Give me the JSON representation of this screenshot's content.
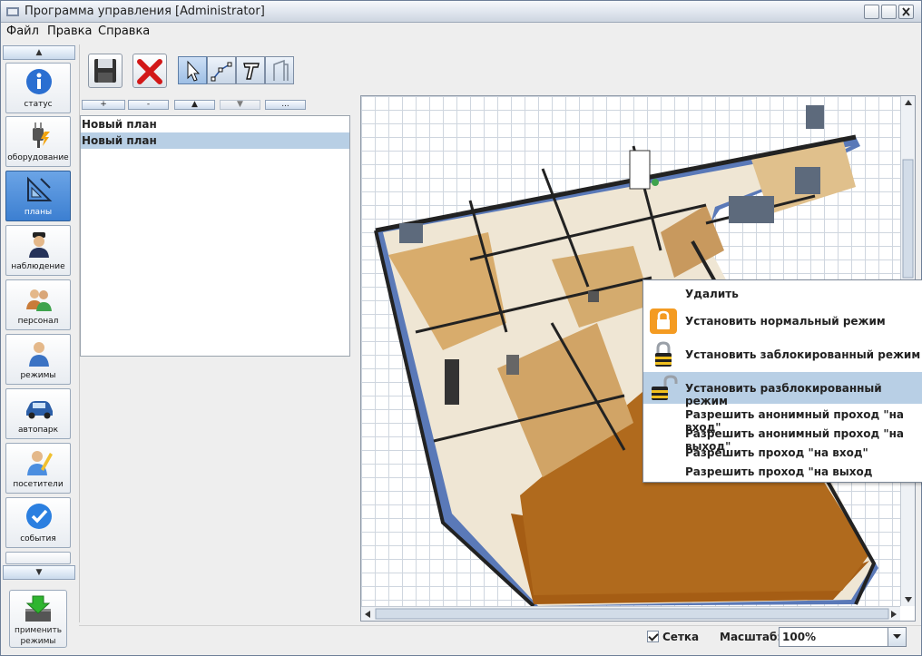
{
  "window": {
    "title": "Программа управления [Administrator]"
  },
  "menu": [
    "Файл",
    "Правка",
    "Справка"
  ],
  "sidebar": {
    "items": [
      {
        "label": "статус",
        "icon": "info-icon"
      },
      {
        "label": "оборудование",
        "icon": "plug-icon"
      },
      {
        "label": "планы",
        "icon": "plan-icon",
        "active": true
      },
      {
        "label": "наблюдение",
        "icon": "guard-icon"
      },
      {
        "label": "персонал",
        "icon": "people-icon"
      },
      {
        "label": "режимы",
        "icon": "person-icon"
      },
      {
        "label": "автопарк",
        "icon": "car-icon"
      },
      {
        "label": "посетители",
        "icon": "visitor-icon"
      },
      {
        "label": "события",
        "icon": "check-icon"
      }
    ],
    "apply_label_line1": "применить",
    "apply_label_line2": "режимы"
  },
  "list": {
    "buttons": [
      "+",
      "-",
      "▲",
      "▼",
      "..."
    ],
    "items": [
      {
        "label": "Новый план",
        "selected": false
      },
      {
        "label": "Новый план",
        "selected": true
      }
    ]
  },
  "context_menu": [
    {
      "label": "Удалить",
      "icon": ""
    },
    {
      "label": "Установить нормальный режим",
      "icon": "lock-orange-icon"
    },
    {
      "label": "Установить заблокированный режим",
      "icon": "lock-closed-icon"
    },
    {
      "label": "Установить разблокированный режим",
      "icon": "lock-open-icon",
      "highlighted": true
    },
    {
      "label": "Разрешить анонимный проход \"на вход\"",
      "icon": ""
    },
    {
      "label": "Разрешить анонимный проход \"на выход\"",
      "icon": ""
    },
    {
      "label": "Разрешить проход \"на вход\"",
      "icon": ""
    },
    {
      "label": "Разрешить проход \"на выход",
      "icon": ""
    }
  ],
  "status": {
    "grid_label": "Сетка",
    "grid_checked": true,
    "scale_label": "Масштаб:",
    "scale_value": "100%"
  }
}
